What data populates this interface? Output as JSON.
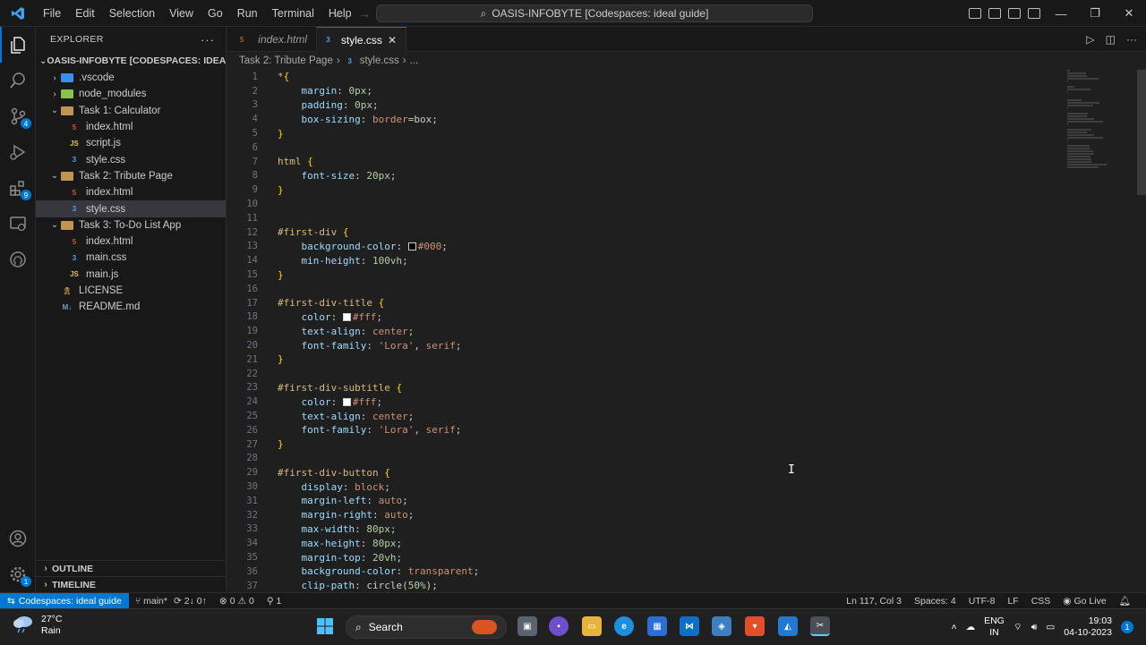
{
  "titlebar": {
    "menu": [
      "File",
      "Edit",
      "Selection",
      "View",
      "Go",
      "Run",
      "Terminal",
      "Help"
    ],
    "command_center": "OASIS-INFOBYTE [Codespaces: ideal guide]"
  },
  "explorer": {
    "header": "EXPLORER",
    "root": "OASIS-INFOBYTE [CODESPACES: IDEAL GUI...",
    "items": [
      {
        "label": ".vscode",
        "kind": "folder",
        "depth": 1,
        "collapsed": true,
        "icon": "vscode-folder-icon"
      },
      {
        "label": "node_modules",
        "kind": "folder",
        "depth": 1,
        "collapsed": true,
        "icon": "node-folder-icon"
      },
      {
        "label": "Task 1: Calculator",
        "kind": "folder",
        "depth": 1,
        "collapsed": false,
        "icon": "folder-open-icon"
      },
      {
        "label": "index.html",
        "kind": "html",
        "depth": 2
      },
      {
        "label": "script.js",
        "kind": "js",
        "depth": 2
      },
      {
        "label": "style.css",
        "kind": "css",
        "depth": 2
      },
      {
        "label": "Task 2: Tribute Page",
        "kind": "folder",
        "depth": 1,
        "collapsed": false,
        "icon": "folder-open-icon"
      },
      {
        "label": "index.html",
        "kind": "html",
        "depth": 2
      },
      {
        "label": "style.css",
        "kind": "css",
        "depth": 2,
        "selected": true
      },
      {
        "label": "Task 3: To-Do List App",
        "kind": "folder",
        "depth": 1,
        "collapsed": false,
        "icon": "folder-open-icon"
      },
      {
        "label": "index.html",
        "kind": "html",
        "depth": 2
      },
      {
        "label": "main.css",
        "kind": "css",
        "depth": 2
      },
      {
        "label": "main.js",
        "kind": "js",
        "depth": 2
      },
      {
        "label": "LICENSE",
        "kind": "license",
        "depth": 1
      },
      {
        "label": "README.md",
        "kind": "md",
        "depth": 1
      }
    ],
    "outline": "OUTLINE",
    "timeline": "TIMELINE"
  },
  "activity_badges": {
    "source_control": "4",
    "extensions": "9",
    "settings": "1"
  },
  "tabs": [
    {
      "label": "index.html",
      "active": false
    },
    {
      "label": "style.css",
      "active": true
    }
  ],
  "breadcrumb": {
    "folder": "Task 2: Tribute Page",
    "file": "style.css",
    "more": "..."
  },
  "code_lines": [
    [
      [
        "sel",
        "*"
      ],
      [
        "brace",
        "{"
      ]
    ],
    [
      [
        "ind",
        "    "
      ],
      [
        "prop",
        "margin"
      ],
      [
        "punc",
        ": "
      ],
      [
        "num",
        "0px"
      ],
      [
        "punc",
        ";"
      ]
    ],
    [
      [
        "ind",
        "    "
      ],
      [
        "prop",
        "padding"
      ],
      [
        "punc",
        ": "
      ],
      [
        "num",
        "0px"
      ],
      [
        "punc",
        ";"
      ]
    ],
    [
      [
        "ind",
        "    "
      ],
      [
        "prop",
        "box-sizing"
      ],
      [
        "punc",
        ": "
      ],
      [
        "val",
        "border"
      ],
      [
        "punc",
        "="
      ],
      [
        "punc",
        "box;"
      ]
    ],
    [
      [
        "brace",
        "}"
      ]
    ],
    [],
    [
      [
        "sel",
        "html "
      ],
      [
        "brace",
        "{"
      ]
    ],
    [
      [
        "ind",
        "    "
      ],
      [
        "prop",
        "font-size"
      ],
      [
        "punc",
        ": "
      ],
      [
        "num",
        "20px"
      ],
      [
        "punc",
        ";"
      ]
    ],
    [
      [
        "brace",
        "}"
      ]
    ],
    [],
    [],
    [
      [
        "sel",
        "#first-div "
      ],
      [
        "brace",
        "{"
      ]
    ],
    [
      [
        "ind",
        "    "
      ],
      [
        "prop",
        "background-color"
      ],
      [
        "punc",
        ": "
      ],
      [
        "swatch",
        "#000000"
      ],
      [
        "val",
        "#000"
      ],
      [
        "punc",
        ";"
      ]
    ],
    [
      [
        "ind",
        "    "
      ],
      [
        "prop",
        "min-height"
      ],
      [
        "punc",
        ": "
      ],
      [
        "num",
        "100vh"
      ],
      [
        "punc",
        ";"
      ]
    ],
    [
      [
        "brace",
        "}"
      ]
    ],
    [],
    [
      [
        "sel",
        "#first-div-title "
      ],
      [
        "brace",
        "{"
      ]
    ],
    [
      [
        "ind",
        "    "
      ],
      [
        "prop",
        "color"
      ],
      [
        "punc",
        ": "
      ],
      [
        "swatch",
        "#ffffff"
      ],
      [
        "val",
        "#fff"
      ],
      [
        "punc",
        ";"
      ]
    ],
    [
      [
        "ind",
        "    "
      ],
      [
        "prop",
        "text-align"
      ],
      [
        "punc",
        ": "
      ],
      [
        "val",
        "center"
      ],
      [
        "punc",
        ";"
      ]
    ],
    [
      [
        "ind",
        "    "
      ],
      [
        "prop",
        "font-family"
      ],
      [
        "punc",
        ": "
      ],
      [
        "val",
        "'Lora'"
      ],
      [
        "punc",
        ", "
      ],
      [
        "val",
        "serif"
      ],
      [
        "punc",
        ";"
      ]
    ],
    [
      [
        "brace",
        "}"
      ]
    ],
    [],
    [
      [
        "sel",
        "#first-div-subtitle "
      ],
      [
        "brace",
        "{"
      ]
    ],
    [
      [
        "ind",
        "    "
      ],
      [
        "prop",
        "color"
      ],
      [
        "punc",
        ": "
      ],
      [
        "swatch",
        "#ffffff"
      ],
      [
        "val",
        "#fff"
      ],
      [
        "punc",
        ";"
      ]
    ],
    [
      [
        "ind",
        "    "
      ],
      [
        "prop",
        "text-align"
      ],
      [
        "punc",
        ": "
      ],
      [
        "val",
        "center"
      ],
      [
        "punc",
        ";"
      ]
    ],
    [
      [
        "ind",
        "    "
      ],
      [
        "prop",
        "font-family"
      ],
      [
        "punc",
        ": "
      ],
      [
        "val",
        "'Lora'"
      ],
      [
        "punc",
        ", "
      ],
      [
        "val",
        "serif"
      ],
      [
        "punc",
        ";"
      ]
    ],
    [
      [
        "brace",
        "}"
      ]
    ],
    [],
    [
      [
        "sel",
        "#first-div-button "
      ],
      [
        "brace",
        "{"
      ]
    ],
    [
      [
        "ind",
        "    "
      ],
      [
        "prop",
        "display"
      ],
      [
        "punc",
        ": "
      ],
      [
        "val",
        "block"
      ],
      [
        "punc",
        ";"
      ]
    ],
    [
      [
        "ind",
        "    "
      ],
      [
        "prop",
        "margin-left"
      ],
      [
        "punc",
        ": "
      ],
      [
        "val",
        "auto"
      ],
      [
        "punc",
        ";"
      ]
    ],
    [
      [
        "ind",
        "    "
      ],
      [
        "prop",
        "margin-right"
      ],
      [
        "punc",
        ": "
      ],
      [
        "val",
        "auto"
      ],
      [
        "punc",
        ";"
      ]
    ],
    [
      [
        "ind",
        "    "
      ],
      [
        "prop",
        "max-width"
      ],
      [
        "punc",
        ": "
      ],
      [
        "num",
        "80px"
      ],
      [
        "punc",
        ";"
      ]
    ],
    [
      [
        "ind",
        "    "
      ],
      [
        "prop",
        "max-height"
      ],
      [
        "punc",
        ": "
      ],
      [
        "num",
        "80px"
      ],
      [
        "punc",
        ";"
      ]
    ],
    [
      [
        "ind",
        "    "
      ],
      [
        "prop",
        "margin-top"
      ],
      [
        "punc",
        ": "
      ],
      [
        "num",
        "20vh"
      ],
      [
        "punc",
        ";"
      ]
    ],
    [
      [
        "ind",
        "    "
      ],
      [
        "prop",
        "background-color"
      ],
      [
        "punc",
        ": "
      ],
      [
        "val",
        "transparent"
      ],
      [
        "punc",
        ";"
      ]
    ],
    [
      [
        "ind",
        "    "
      ],
      [
        "prop",
        "clip-path"
      ],
      [
        "punc",
        ": "
      ],
      [
        "punc",
        "circle("
      ],
      [
        "num",
        "50%"
      ],
      [
        "punc",
        ");"
      ]
    ]
  ],
  "statusbar": {
    "remote": "Codespaces: ideal guide",
    "branch": "main*",
    "sync": "2↓ 0↑",
    "errors": "0",
    "warnings": "0",
    "ports": "1",
    "position": "Ln 117, Col 3",
    "spaces": "Spaces: 4",
    "encoding": "UTF-8",
    "eol": "LF",
    "language": "CSS",
    "golive": "Go Live"
  },
  "taskbar": {
    "temp": "27°C",
    "weather": "Rain",
    "search": "Search",
    "lang1": "ENG",
    "lang2": "IN",
    "time": "19:03",
    "date": "04-10-2023"
  }
}
